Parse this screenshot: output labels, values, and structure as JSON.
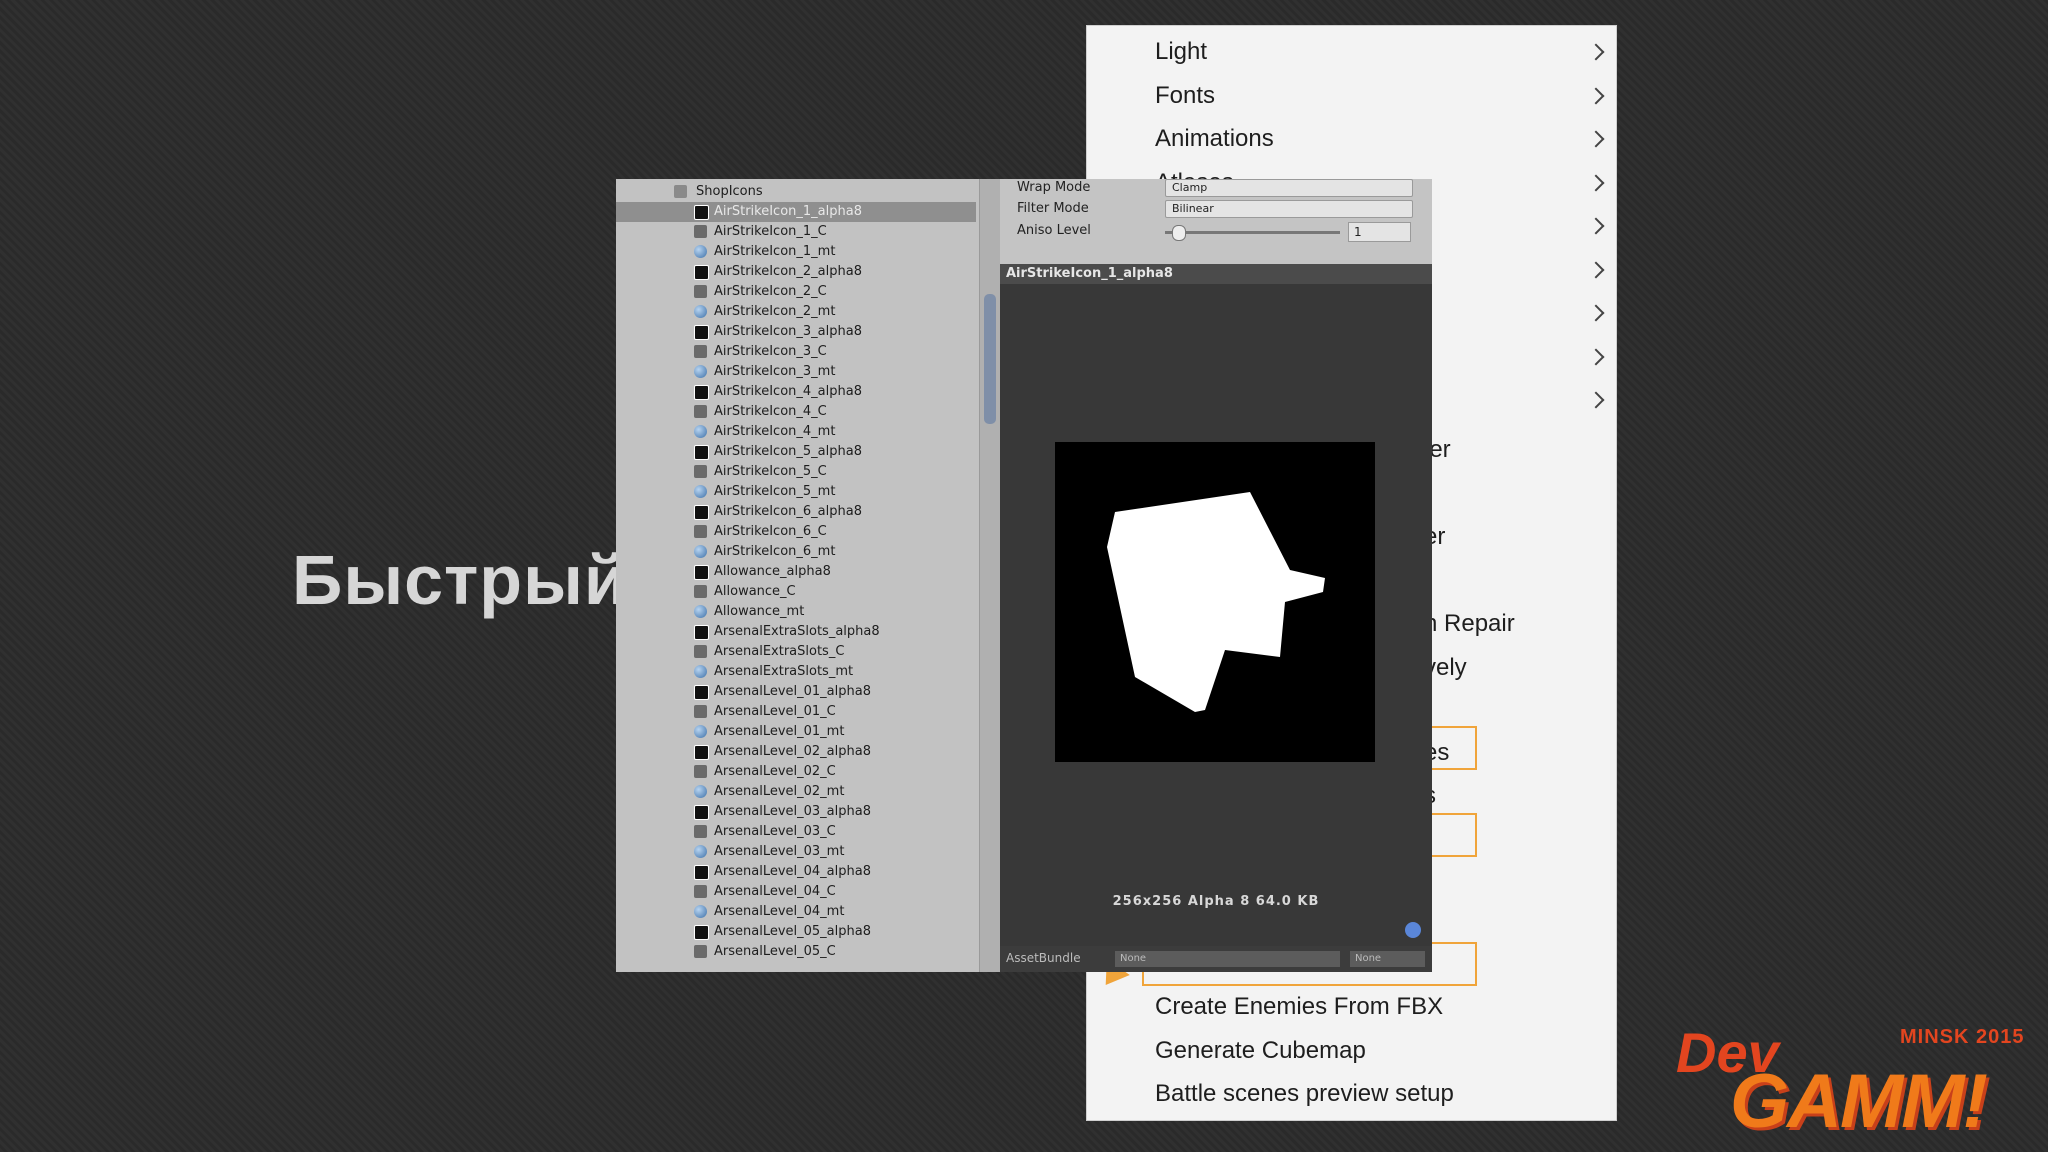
{
  "slide": {
    "title": "Быстрый"
  },
  "menu": {
    "items": [
      {
        "label": "Light",
        "submenu": true
      },
      {
        "label": "Fonts",
        "submenu": true
      },
      {
        "label": "Animations",
        "submenu": true
      },
      {
        "label": "Atlases",
        "submenu": true
      },
      {
        "label": "",
        "submenu": true
      },
      {
        "label": "",
        "submenu": true
      },
      {
        "label": "",
        "submenu": true
      },
      {
        "label": "",
        "submenu": true
      },
      {
        "label": "",
        "submenu": true
      }
    ],
    "partial_items": [
      "ier",
      "er",
      "n Repair",
      "vely",
      "es",
      "s"
    ],
    "bottom_items": [
      "Create Enemies From FBX",
      "Generate Cubemap",
      "Battle scenes preview setup"
    ]
  },
  "project": {
    "folder": "ShopIcons",
    "selected": "AirStrikeIcon_1_alpha8",
    "items": [
      {
        "name": "AirStrikeIcon_1_alpha8",
        "icon": "alpha-texture-icon"
      },
      {
        "name": "AirStrikeIcon_1_C",
        "icon": "color-texture-icon"
      },
      {
        "name": "AirStrikeIcon_1_mt",
        "icon": "material-icon"
      },
      {
        "name": "AirStrikeIcon_2_alpha8",
        "icon": "alpha-texture-icon"
      },
      {
        "name": "AirStrikeIcon_2_C",
        "icon": "color-texture-icon"
      },
      {
        "name": "AirStrikeIcon_2_mt",
        "icon": "material-icon"
      },
      {
        "name": "AirStrikeIcon_3_alpha8",
        "icon": "alpha-texture-icon"
      },
      {
        "name": "AirStrikeIcon_3_C",
        "icon": "color-texture-icon"
      },
      {
        "name": "AirStrikeIcon_3_mt",
        "icon": "material-icon"
      },
      {
        "name": "AirStrikeIcon_4_alpha8",
        "icon": "alpha-texture-icon"
      },
      {
        "name": "AirStrikeIcon_4_C",
        "icon": "color-texture-icon"
      },
      {
        "name": "AirStrikeIcon_4_mt",
        "icon": "material-icon"
      },
      {
        "name": "AirStrikeIcon_5_alpha8",
        "icon": "alpha-texture-icon"
      },
      {
        "name": "AirStrikeIcon_5_C",
        "icon": "color-texture-icon"
      },
      {
        "name": "AirStrikeIcon_5_mt",
        "icon": "material-icon"
      },
      {
        "name": "AirStrikeIcon_6_alpha8",
        "icon": "alpha-texture-icon"
      },
      {
        "name": "AirStrikeIcon_6_C",
        "icon": "color-texture-icon"
      },
      {
        "name": "AirStrikeIcon_6_mt",
        "icon": "material-icon"
      },
      {
        "name": "Allowance_alpha8",
        "icon": "alpha-texture-icon"
      },
      {
        "name": "Allowance_C",
        "icon": "color-texture-icon"
      },
      {
        "name": "Allowance_mt",
        "icon": "material-icon"
      },
      {
        "name": "ArsenalExtraSlots_alpha8",
        "icon": "alpha-texture-icon"
      },
      {
        "name": "ArsenalExtraSlots_C",
        "icon": "color-texture-icon"
      },
      {
        "name": "ArsenalExtraSlots_mt",
        "icon": "material-icon"
      },
      {
        "name": "ArsenalLevel_01_alpha8",
        "icon": "alpha-texture-icon"
      },
      {
        "name": "ArsenalLevel_01_C",
        "icon": "color-texture-icon"
      },
      {
        "name": "ArsenalLevel_01_mt",
        "icon": "material-icon"
      },
      {
        "name": "ArsenalLevel_02_alpha8",
        "icon": "alpha-texture-icon"
      },
      {
        "name": "ArsenalLevel_02_C",
        "icon": "color-texture-icon"
      },
      {
        "name": "ArsenalLevel_02_mt",
        "icon": "material-icon"
      },
      {
        "name": "ArsenalLevel_03_alpha8",
        "icon": "alpha-texture-icon"
      },
      {
        "name": "ArsenalLevel_03_C",
        "icon": "color-texture-icon"
      },
      {
        "name": "ArsenalLevel_03_mt",
        "icon": "material-icon"
      },
      {
        "name": "ArsenalLevel_04_alpha8",
        "icon": "alpha-texture-icon"
      },
      {
        "name": "ArsenalLevel_04_C",
        "icon": "color-texture-icon"
      },
      {
        "name": "ArsenalLevel_04_mt",
        "icon": "material-icon"
      },
      {
        "name": "ArsenalLevel_05_alpha8",
        "icon": "alpha-texture-icon"
      },
      {
        "name": "ArsenalLevel_05_C",
        "icon": "color-texture-icon"
      }
    ]
  },
  "inspector": {
    "wrap_mode_label": "Wrap Mode",
    "wrap_mode_value": "Clamp",
    "filter_mode_label": "Filter Mode",
    "filter_mode_value": "Bilinear",
    "aniso_label": "Aniso Level",
    "aniso_value": "1",
    "preview_title": "AirStrikeIcon_1_alpha8",
    "preview_info": "256x256  Alpha 8  64.0 KB",
    "assetbundle_label": "AssetBundle",
    "assetbundle_value": "None",
    "assetbundle_variant": "None"
  },
  "logo": {
    "dev": "Dev",
    "gamm": "GAMM!",
    "city": "MINSK 2015"
  },
  "colors": {
    "accent_orange": "#f0a43a",
    "logo_red": "#e3451f",
    "selection": "#8f8f8f"
  }
}
